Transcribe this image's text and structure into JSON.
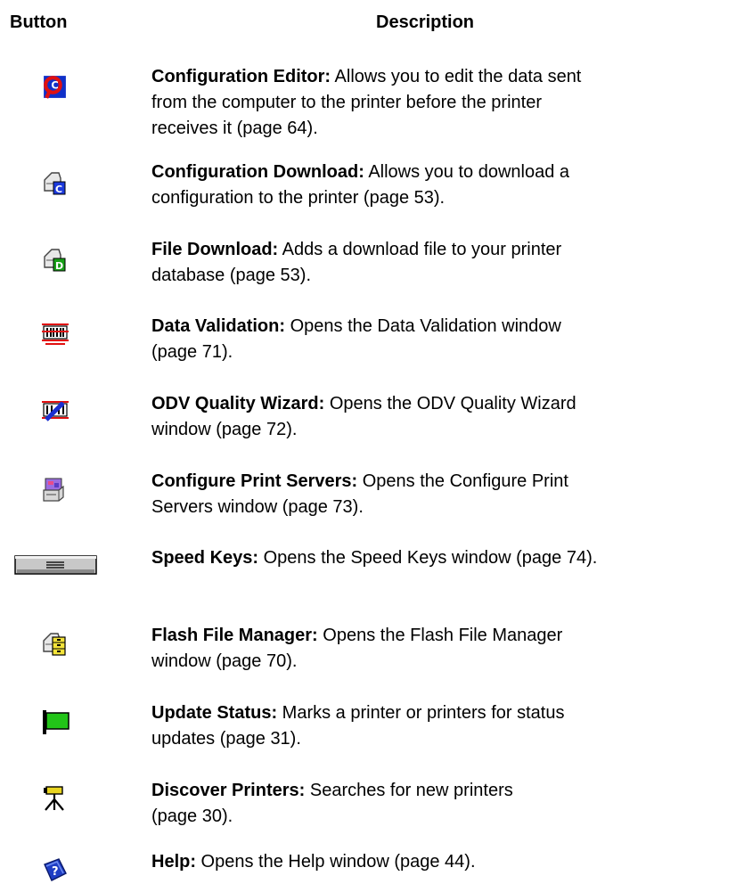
{
  "header": {
    "button": "Button",
    "description": "Description"
  },
  "rows": [
    {
      "icon": "configuration-editor-icon",
      "title": "Configuration Editor:",
      "lines": [
        " Allows you to edit the data sent",
        "from the computer to the printer before the printer",
        "receives it (page 64)."
      ]
    },
    {
      "icon": "configuration-download-icon",
      "title": "Configuration Download:",
      "lines": [
        " Allows you to download a",
        "configuration to the printer (page 53)."
      ]
    },
    {
      "icon": "file-download-icon",
      "title": "File Download:",
      "lines": [
        " Adds a download file to your printer",
        "database (page 53)."
      ]
    },
    {
      "icon": "data-validation-icon",
      "title": "Data Validation:",
      "lines": [
        " Opens the Data Validation window",
        "(page 71)."
      ]
    },
    {
      "icon": "odv-quality-wizard-icon",
      "title": "ODV Quality Wizard:",
      "lines": [
        " Opens the ODV Quality Wizard",
        "window (page 72)."
      ]
    },
    {
      "icon": "configure-print-servers-icon",
      "title": "Configure Print Servers:",
      "lines": [
        " Opens the Configure Print",
        "Servers window (page 73)."
      ]
    },
    {
      "icon": "speed-keys-icon",
      "title": "Speed Keys:",
      "lines": [
        " Opens the Speed Keys window (page 74)."
      ]
    },
    {
      "icon": "flash-file-manager-icon",
      "title": "Flash File Manager:",
      "lines": [
        " Opens the Flash File Manager",
        "window (page 70)."
      ]
    },
    {
      "icon": "update-status-icon",
      "title": "Update Status:",
      "lines": [
        " Marks a printer or printers for status",
        "updates (page 31)."
      ]
    },
    {
      "icon": "discover-printers-icon",
      "title": "Discover Printers:",
      "lines": [
        " Searches for new printers",
        "(page 30)."
      ]
    },
    {
      "icon": "help-icon",
      "title": "Help:",
      "lines": [
        " Opens the Help window (page 44)."
      ]
    }
  ]
}
